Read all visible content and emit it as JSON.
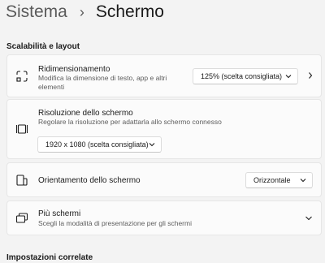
{
  "breadcrumb": {
    "parent": "Sistema",
    "separator": "›",
    "current": "Schermo"
  },
  "section_scale": {
    "title": "Scalabilità e layout"
  },
  "scale_card": {
    "title": "Ridimensionamento",
    "description": "Modifica la dimensione di testo, app e altri elementi",
    "dropdown_value": "125% (scelta consigliata)",
    "icon": "scale-icon"
  },
  "resolution_card": {
    "title": "Risoluzione dello schermo",
    "description": "Regolare la risoluzione per adattarla allo schermo connesso",
    "dropdown_value": "1920 x 1080 (scelta consigliata)",
    "icon": "resolution-icon"
  },
  "orientation_card": {
    "title": "Orientamento dello schermo",
    "dropdown_value": "Orizzontale",
    "icon": "orientation-icon"
  },
  "multi_card": {
    "title": "Più schermi",
    "description": "Scegli la modalità di presentazione per gli schermi",
    "icon": "multiple-displays-icon"
  },
  "section_related": {
    "title": "Impostazioni correlate"
  },
  "colors": {
    "background": "#f3f3f3",
    "card": "#fbfbfb",
    "border": "#e6e6e6",
    "text": "#1b1b1b",
    "secondary_text": "#5d5d5d"
  }
}
